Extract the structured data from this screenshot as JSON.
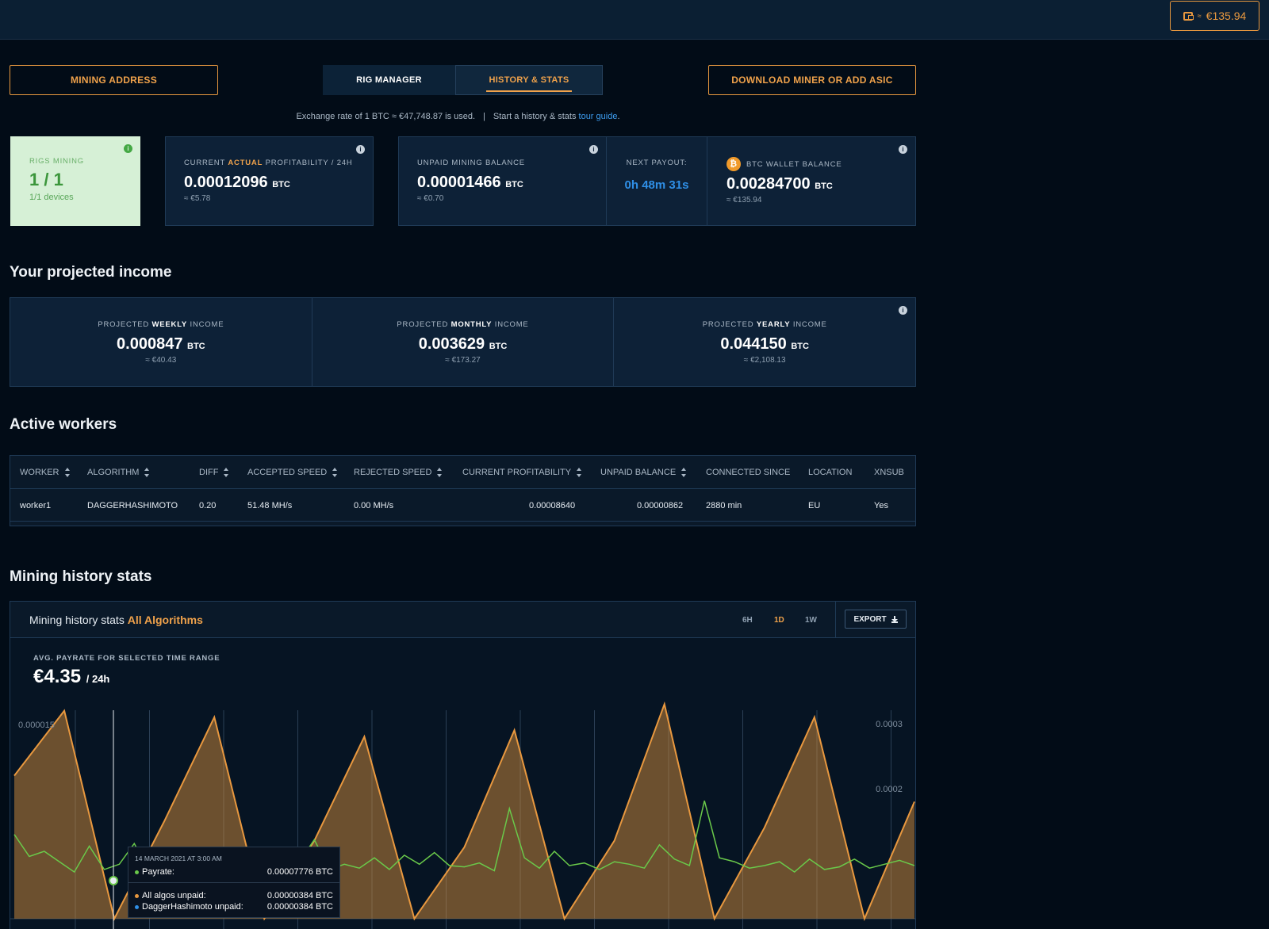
{
  "topbar": {
    "wallet_prefix": "≈",
    "wallet_amount": "€135.94"
  },
  "actions": {
    "mining_address": "MINING ADDRESS",
    "download": "DOWNLOAD MINER OR ADD ASIC"
  },
  "tabs": [
    {
      "label": "RIG MANAGER"
    },
    {
      "label": "HISTORY & STATS"
    }
  ],
  "exchange": {
    "text": "Exchange rate of 1 BTC ≈ €47,748.87 is used.",
    "separator": "|",
    "guide_prefix": "Start a history & stats",
    "guide_link": "tour guide",
    "guide_suffix": "."
  },
  "stats": {
    "rigs": {
      "label": "RIGS MINING",
      "value": "1 / 1",
      "sub": "1/1 devices"
    },
    "profit": {
      "label_a": "CURRENT",
      "label_b": "ACTUAL",
      "label_c": "PROFITABILITY / 24H",
      "value": "0.00012096",
      "unit": "BTC",
      "sub": "≈ €5.78"
    },
    "unpaid": {
      "label": "UNPAID MINING BALANCE",
      "value": "0.00001466",
      "unit": "BTC",
      "sub": "≈ €0.70"
    },
    "payout": {
      "label": "NEXT PAYOUT:",
      "value": "0h 48m 31s"
    },
    "wallet": {
      "label": "BTC WALLET BALANCE",
      "value": "0.00284700",
      "unit": "BTC",
      "sub": "≈ €135.94",
      "coin_glyph": "₿"
    }
  },
  "projected": {
    "title": "Your projected income",
    "items": [
      {
        "pre": "PROJECTED",
        "bold": "WEEKLY",
        "post": "INCOME",
        "value": "0.000847",
        "unit": "BTC",
        "sub": "≈ €40.43"
      },
      {
        "pre": "PROJECTED",
        "bold": "MONTHLY",
        "post": "INCOME",
        "value": "0.003629",
        "unit": "BTC",
        "sub": "≈ €173.27"
      },
      {
        "pre": "PROJECTED",
        "bold": "YEARLY",
        "post": "INCOME",
        "value": "0.044150",
        "unit": "BTC",
        "sub": "≈ €2,108.13"
      }
    ]
  },
  "workers": {
    "title": "Active workers",
    "columns": [
      "WORKER",
      "ALGORITHM",
      "DIFF",
      "ACCEPTED SPEED",
      "REJECTED SPEED",
      "CURRENT PROFITABILITY",
      "UNPAID BALANCE",
      "CONNECTED SINCE",
      "LOCATION",
      "XNSUB"
    ],
    "rows": [
      [
        "worker1",
        "DAGGERHASHIMOTO",
        "0.20",
        "51.48 MH/s",
        "0.00 MH/s",
        "0.00008640",
        "0.00000862",
        "2880 min",
        "EU",
        "Yes"
      ]
    ]
  },
  "history": {
    "title": "Mining history stats",
    "panel_title": "Mining history stats",
    "panel_highlight": "All Algorithms",
    "ranges": [
      "6H",
      "1D",
      "1W"
    ],
    "active_range": "1D",
    "export": "EXPORT",
    "avg_label": "AVG. PAYRATE FOR SELECTED TIME RANGE",
    "avg_value": "€4.35",
    "avg_unit": "/ 24h",
    "tooltip": {
      "date": "14 MARCH 2021 AT 3:00 AM",
      "payrate_label": "Payrate:",
      "payrate_value": "0.00007776 BTC",
      "all_label": "All algos unpaid:",
      "all_value": "0.00000384 BTC",
      "dagger_label": "DaggerHashimoto unpaid:",
      "dagger_value": "0.00000384 BTC"
    }
  },
  "chart_data": {
    "type": "area",
    "series": [
      {
        "name": "Payrate",
        "color": "#6ac94a",
        "axis": "left",
        "values": [
          6.5e-06,
          4.8e-06,
          5.2e-06,
          4.4e-06,
          3.6e-06,
          5.6e-06,
          3.8e-06,
          4.2e-06,
          5.8e-06,
          3.6e-06,
          4.4e-06,
          4e-06,
          4.6e-06,
          3.9e-06,
          4.5e-06,
          3.6e-06,
          4.1e-06,
          4.9e-06,
          3.8e-06,
          4.4e-06,
          6.1e-06,
          3.8e-06,
          4.2e-06,
          3.9e-06,
          4.7e-06,
          3.8e-06,
          4.9e-06,
          4.2e-06,
          5.1e-06,
          4.1e-06,
          4e-06,
          4.3e-06,
          3.7e-06,
          8.5e-06,
          4.7e-06,
          3.9e-06,
          5.2e-06,
          4.1e-06,
          4.3e-06,
          3.8e-06,
          4.4e-06,
          4.2e-06,
          3.9e-06,
          5.7e-06,
          4.6e-06,
          4.1e-06,
          9.1e-06,
          4.7e-06,
          4.4e-06,
          3.9e-06,
          4.1e-06,
          4.4e-06,
          3.6e-06,
          4.6e-06,
          3.8e-06,
          4e-06,
          4.6e-06,
          3.9e-06,
          4.2e-06,
          4.5e-06,
          4.1e-06
        ]
      },
      {
        "name": "All algos unpaid",
        "color": "#e8983f",
        "axis": "right",
        "values": [
          0.00022,
          0.00032,
          0.0,
          0.00015,
          0.00031,
          0.0,
          0.00012,
          0.00028,
          0.0,
          0.00011,
          0.00029,
          0.0,
          0.00012,
          0.00033,
          0.0,
          0.00014,
          0.00031,
          0.0,
          0.00018
        ]
      }
    ],
    "left_axis": {
      "ticks": [
        "0.000015"
      ]
    },
    "right_axis": {
      "ticks": [
        "0.0003",
        "0.0002"
      ]
    },
    "grid": "vertical"
  }
}
